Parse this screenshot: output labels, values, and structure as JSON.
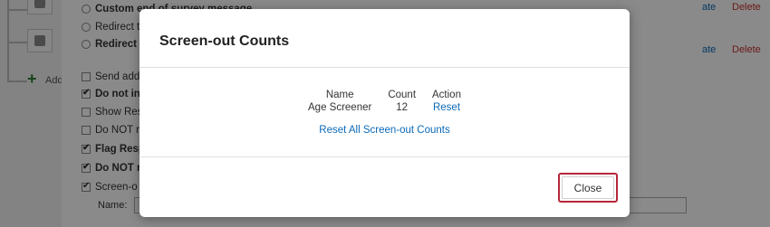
{
  "background": {
    "options": [
      {
        "label": "Custom end of survey message",
        "type": "radio",
        "bold": true
      },
      {
        "label": "Redirect t",
        "type": "radio",
        "bold": false
      },
      {
        "label": "Redirect t",
        "type": "radio",
        "bold": true
      },
      {
        "label": "Send add",
        "type": "checkbox",
        "checked": false,
        "bold": false
      },
      {
        "label": "Do not inc",
        "type": "checkbox",
        "checked": true,
        "bold": true
      },
      {
        "label": "Show Res",
        "type": "checkbox",
        "checked": false,
        "bold": false
      },
      {
        "label": "Do NOT re",
        "type": "checkbox",
        "checked": false,
        "bold": false
      },
      {
        "label": "Flag Resp",
        "type": "checkbox",
        "checked": true,
        "bold": true
      },
      {
        "label": "Do NOT re",
        "type": "checkbox",
        "checked": true,
        "bold": true
      },
      {
        "label": "Screen-o",
        "type": "checkbox",
        "checked": true,
        "bold": false
      }
    ],
    "edit_label_1": "ate",
    "delete_label_1": "Delete",
    "edit_label_2": "ate",
    "delete_label_2": "Delete",
    "add_label": "Add",
    "name_label": "Name:"
  },
  "modal": {
    "title": "Screen-out Counts",
    "headers": {
      "name": "Name",
      "count": "Count",
      "action": "Action"
    },
    "rows": [
      {
        "name": "Age Screener",
        "count": "12",
        "action": "Reset"
      }
    ],
    "reset_all": "Reset All Screen-out Counts",
    "close_label": "Close"
  },
  "colors": {
    "link": "#0b6ab8",
    "delete": "#c6312b",
    "close_border": "#b5273a",
    "add": "#2e7d32"
  }
}
